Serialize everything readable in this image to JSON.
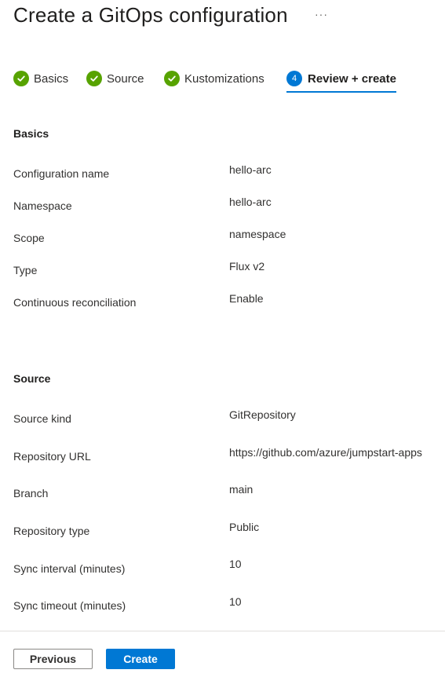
{
  "page": {
    "title": "Create a GitOps configuration",
    "more_label": "···"
  },
  "tabs": [
    {
      "label": "Basics",
      "state": "complete",
      "icon": "check-circle-icon"
    },
    {
      "label": "Source",
      "state": "complete",
      "icon": "check-circle-icon"
    },
    {
      "label": "Kustomizations",
      "state": "complete",
      "icon": "check-circle-icon"
    },
    {
      "label": "Review + create",
      "state": "active",
      "step": "4"
    }
  ],
  "basics": {
    "heading": "Basics",
    "rows": [
      {
        "label": "Configuration name",
        "value": "hello-arc"
      },
      {
        "label": "Namespace",
        "value": "hello-arc"
      },
      {
        "label": "Scope",
        "value": "namespace"
      },
      {
        "label": "Type",
        "value": "Flux v2"
      },
      {
        "label": "Continuous reconciliation",
        "value": "Enable"
      }
    ]
  },
  "source": {
    "heading": "Source",
    "rows": [
      {
        "label": "Source kind",
        "value": "GitRepository"
      },
      {
        "label": "Repository URL",
        "value": "https://github.com/azure/jumpstart-apps"
      },
      {
        "label": "Branch",
        "value": "main"
      },
      {
        "label": "Repository type",
        "value": "Public"
      },
      {
        "label": "Sync interval (minutes)",
        "value": "10"
      },
      {
        "label": "Sync timeout (minutes)",
        "value": "10"
      }
    ]
  },
  "footer": {
    "previous_label": "Previous",
    "create_label": "Create"
  },
  "colors": {
    "accent": "#0078d4",
    "success": "#57a300"
  }
}
